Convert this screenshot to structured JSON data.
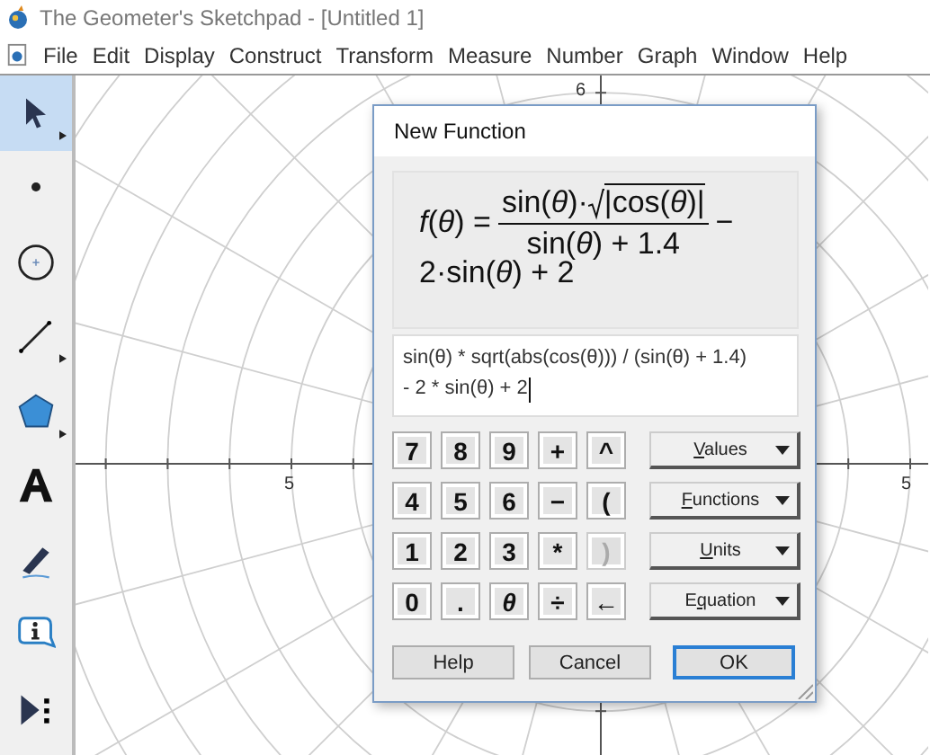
{
  "window": {
    "title": "The Geometer's Sketchpad - [Untitled 1]"
  },
  "menu_bar": [
    "File",
    "Edit",
    "Display",
    "Construct",
    "Transform",
    "Measure",
    "Number",
    "Graph",
    "Window",
    "Help"
  ],
  "toolbox": [
    {
      "kind": "arrow",
      "selected": true,
      "submenu": true
    },
    {
      "kind": "point",
      "selected": false,
      "submenu": false
    },
    {
      "kind": "compass",
      "selected": false,
      "submenu": false
    },
    {
      "kind": "line",
      "selected": false,
      "submenu": true
    },
    {
      "kind": "polygon",
      "selected": false,
      "submenu": true
    },
    {
      "kind": "text",
      "selected": false,
      "submenu": false
    },
    {
      "kind": "marker",
      "selected": false,
      "submenu": false
    },
    {
      "kind": "info",
      "selected": false,
      "submenu": false
    },
    {
      "kind": "custom",
      "selected": false,
      "submenu": false
    }
  ],
  "canvas": {
    "axis_labels": [
      {
        "kind": "top",
        "text": "6"
      },
      {
        "kind": "left",
        "text": "5"
      },
      {
        "kind": "right",
        "text": "5"
      }
    ]
  },
  "dialog": {
    "title": "New Function",
    "preview": {
      "lhs": "*f*(*θ*) =",
      "numerator": "sin(*θ*)·",
      "radicand": "|cos(*θ*)|",
      "denominator": "sin(*θ*) + 1.4",
      "trailing": "−",
      "line_2": "2·sin(*θ*) + 2"
    },
    "expression": {
      "lines": [
        "sin(θ) * sqrt(abs(cos(θ))) / (sin(θ) + 1.4)",
        "- 2 * sin(θ) + 2"
      ]
    },
    "keypad": [
      {
        "keys": [
          {
            "kind": "digit",
            "label": "7",
            "disabled": false
          },
          {
            "kind": "digit",
            "label": "8",
            "disabled": false
          },
          {
            "kind": "digit",
            "label": "9",
            "disabled": false
          },
          {
            "kind": "operator",
            "label": "+",
            "disabled": false
          },
          {
            "kind": "operator",
            "label": "^",
            "disabled": false
          }
        ],
        "menu": {
          "key": "V",
          "after": "alues"
        }
      },
      {
        "keys": [
          {
            "kind": "digit",
            "label": "4",
            "disabled": false
          },
          {
            "kind": "digit",
            "label": "5",
            "disabled": false
          },
          {
            "kind": "digit",
            "label": "6",
            "disabled": false
          },
          {
            "kind": "operator",
            "label": "−",
            "disabled": false
          },
          {
            "kind": "operator",
            "label": "(",
            "disabled": false
          }
        ],
        "menu": {
          "key": "F",
          "after": "unctions"
        }
      },
      {
        "keys": [
          {
            "kind": "digit",
            "label": "1",
            "disabled": false
          },
          {
            "kind": "digit",
            "label": "2",
            "disabled": false
          },
          {
            "kind": "digit",
            "label": "3",
            "disabled": false
          },
          {
            "kind": "operator",
            "label": "*",
            "disabled": false
          },
          {
            "kind": "operator",
            "label": ")",
            "disabled": true
          }
        ],
        "menu": {
          "key": "U",
          "after": "nits"
        }
      },
      {
        "keys": [
          {
            "kind": "digit",
            "label": "0",
            "disabled": false
          },
          {
            "kind": "digit",
            "label": ".",
            "disabled": false
          },
          {
            "kind": "variable",
            "label": "θ",
            "disabled": false
          },
          {
            "kind": "operator",
            "label": "÷",
            "disabled": false
          },
          {
            "kind": "operator",
            "label": "←",
            "disabled": false
          }
        ],
        "menu": {
          "before": "E",
          "key": "q",
          "after": "uation"
        }
      }
    ],
    "buttons": [
      {
        "label": "Help",
        "default": false
      },
      {
        "label": "Cancel",
        "default": false
      },
      {
        "label": "OK",
        "default": true
      }
    ]
  }
}
